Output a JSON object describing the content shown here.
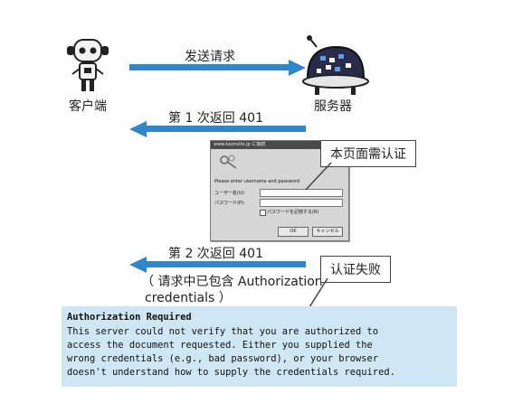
{
  "client_label": "客户端",
  "server_label": "服务器",
  "request_label": "发送请求",
  "return1_label": "第 1 次返回 401",
  "dialog": {
    "title": "www.kaonsite.jp に接続",
    "prompt": "Please enter username and password",
    "user_label": "ユーザー名(U):",
    "user_value": "",
    "password_label": "パスワード(P):",
    "remember_label": "パスワードを記憶する(R)",
    "ok_label": "OK",
    "cancel_label": "キャンセル"
  },
  "callout_auth": "本页面需认证",
  "return2_label": "第 2 次返回 401",
  "return2_note_line1": "（ 请求中已包含 Authorization",
  "return2_note_line2": "credentials ）",
  "callout_fail": "认证失败",
  "error": {
    "title": "Authorization Required",
    "lines": [
      "This server could not verify that you are authorized to",
      "access the document requested. Either you supplied the",
      "wrong credentials (e.g., bad password), or your browser",
      "doesn't understand how to supply the credentials required."
    ]
  },
  "colors": {
    "arrow": "#2f86c8",
    "error_bg": "#cfe6f4"
  }
}
